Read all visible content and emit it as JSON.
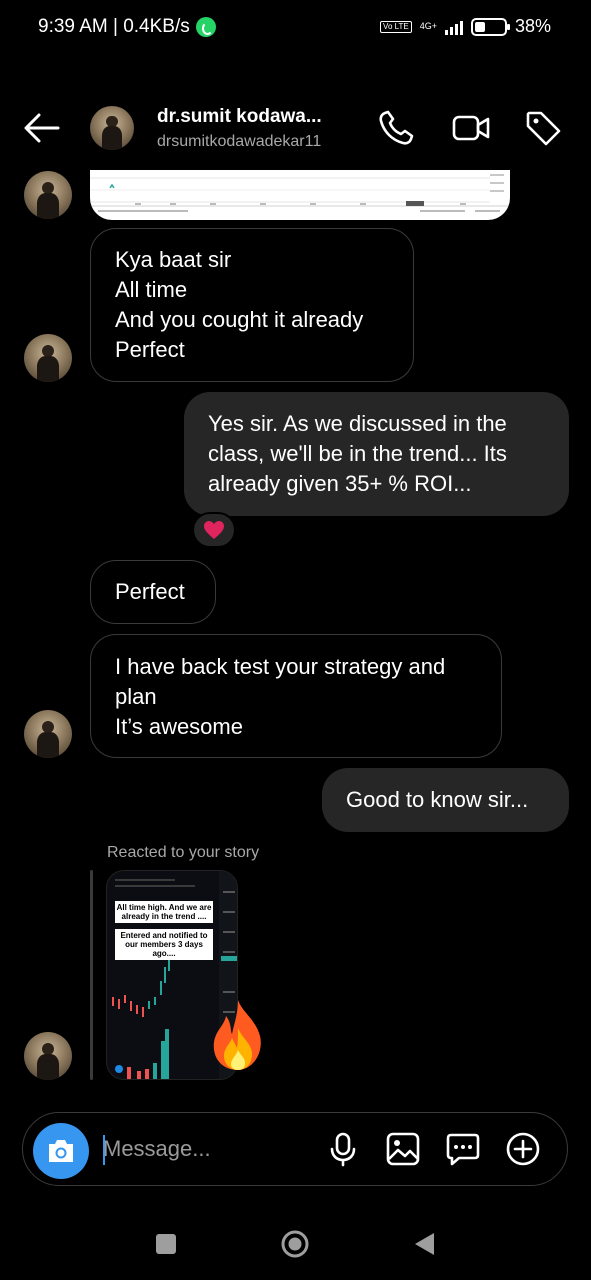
{
  "status": {
    "time_speed": "9:39 AM | 0.4KB/s",
    "volte": "Vo LTE",
    "network": "4G+",
    "battery": "38%"
  },
  "header": {
    "name": "dr.sumit kodawa...",
    "username": "drsumitkodawadekar11",
    "icons": [
      "back-arrow-icon",
      "phone-icon",
      "video-camera-icon",
      "tag-icon"
    ]
  },
  "messages": [
    {
      "from": "them",
      "lines": [
        "Kya baat sir",
        "All time",
        "And you cought it already",
        "Perfect"
      ]
    },
    {
      "from": "me",
      "lines": [
        "Yes sir. As we discussed in the",
        "class, we'll be in the trend...  Its",
        "already given 35+ % ROI..."
      ],
      "reaction": "❤️"
    },
    {
      "from": "them",
      "lines": [
        "Perfect"
      ]
    },
    {
      "from": "them",
      "lines": [
        "I have back test your strategy and",
        "plan",
        "It’s awesome"
      ]
    },
    {
      "from": "me",
      "lines": [
        "Good to know sir..."
      ]
    }
  ],
  "story_reply": {
    "label": "Reacted to your story",
    "caption_1": "All time high. And we are already in the trend ....",
    "caption_2": "Entered and notified to our members 3 days ago....",
    "reaction_emoji": "fire-emoji"
  },
  "composer": {
    "placeholder": "Message...",
    "icons": [
      "camera-icon",
      "microphone-icon",
      "gallery-icon",
      "sticker-chat-icon",
      "plus-icon"
    ]
  },
  "colors": {
    "accent": "#3797f0",
    "sent_bubble": "#262626",
    "received_border": "#3a3a3a",
    "secondary_text": "#a8a8a8"
  }
}
